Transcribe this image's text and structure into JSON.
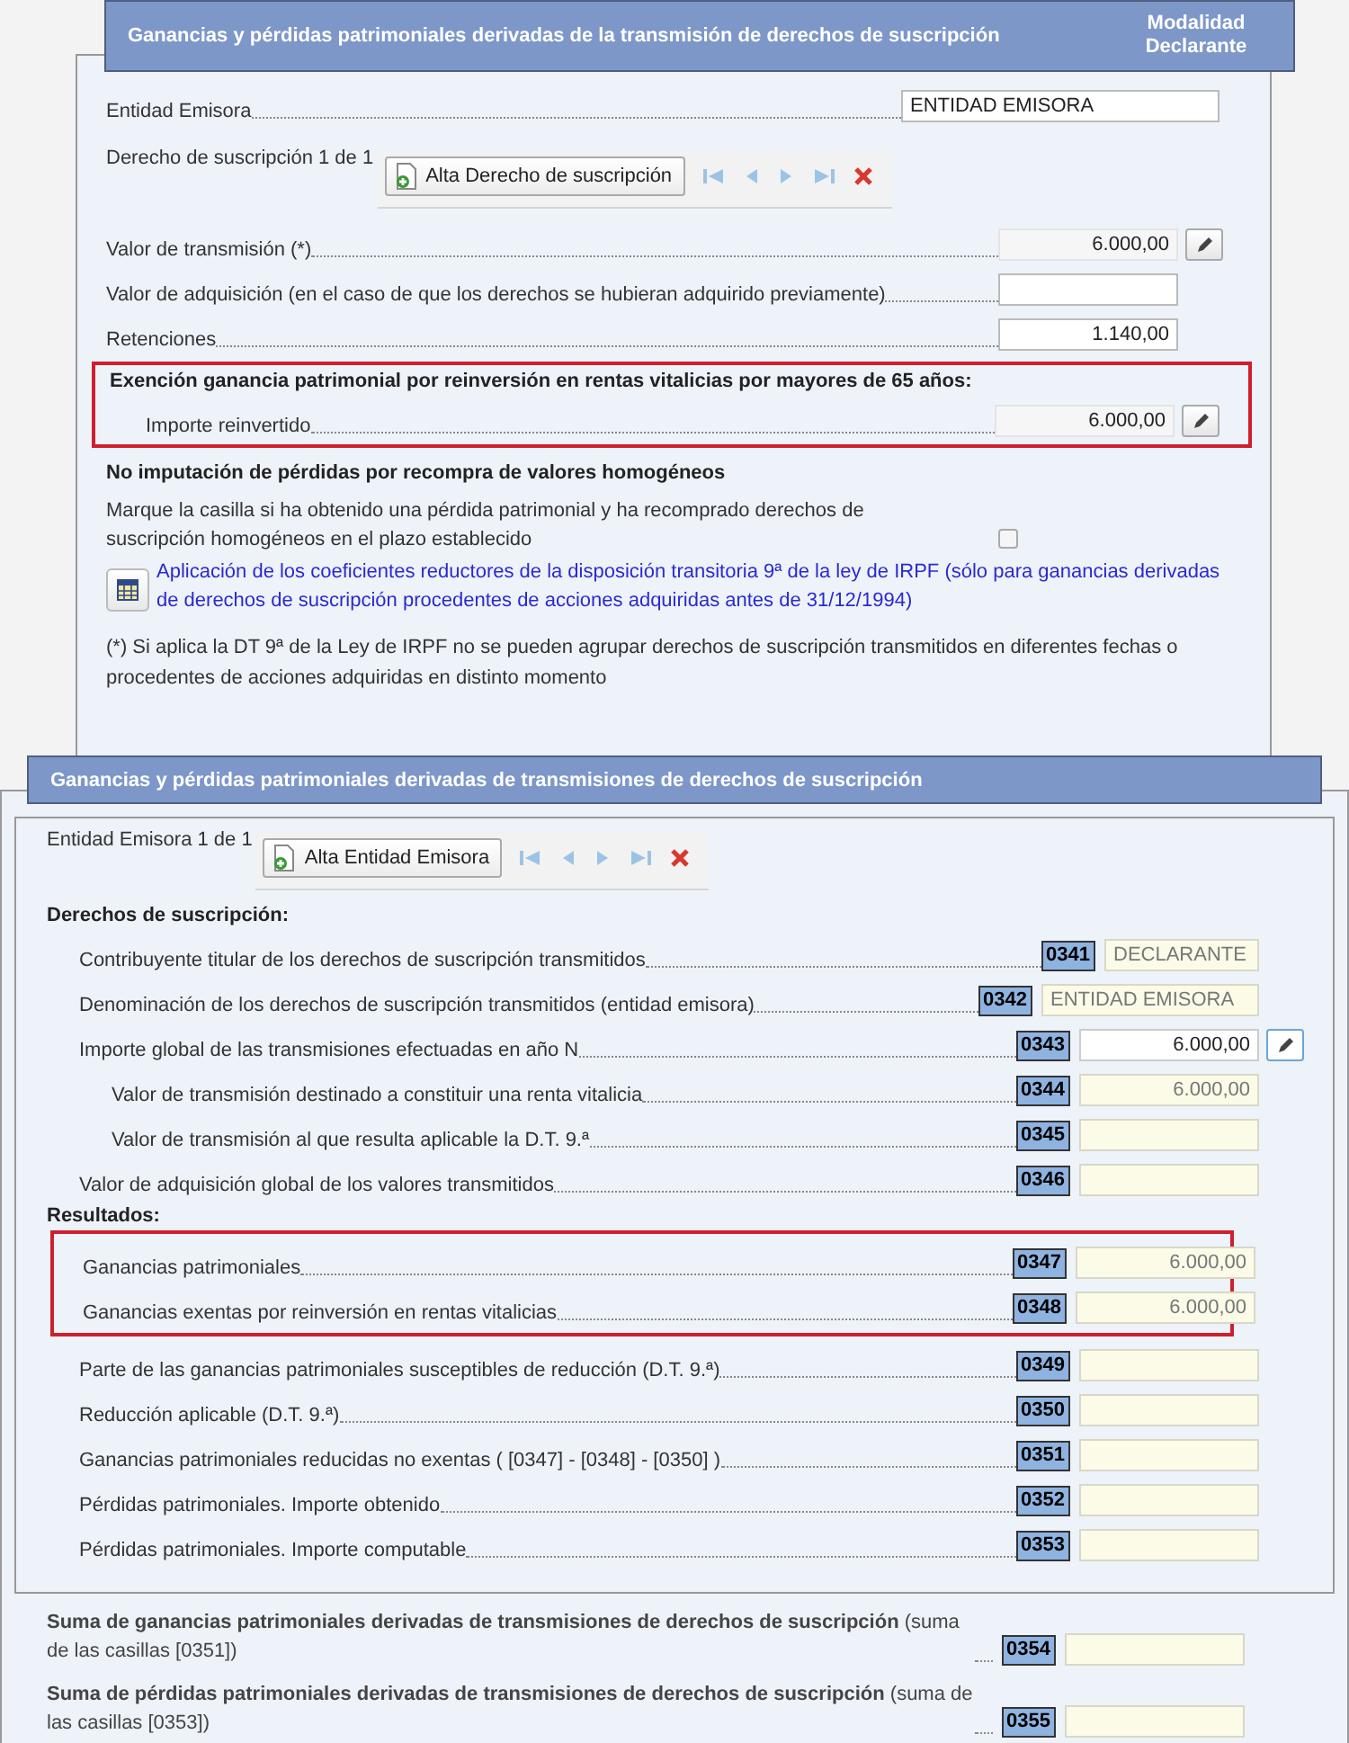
{
  "section_1": {
    "title": "Ganancias y pérdidas patrimoniales derivadas de la transmisión de derechos de suscripción",
    "mode_label": "Modalidad Declarante",
    "items": [
      {
        "kind": "text_field",
        "label": "Entidad Emisora",
        "value": "ENTIDAD EMISORA",
        "readonly": false,
        "edit_button": false
      },
      {
        "kind": "pager",
        "label": "Derecho de suscripción 1 de 1",
        "add_button": "Alta Derecho de suscripción"
      },
      {
        "kind": "amount_field",
        "label": "Valor de transmisión (*)",
        "value": "6.000,00",
        "readonly": true,
        "edit_button": true
      },
      {
        "kind": "amount_field",
        "label": "Valor de adquisición (en el caso de que los derechos se hubieran adquirido previamente)",
        "readonly": false,
        "edit_button": false
      },
      {
        "kind": "amount_field",
        "label": "Retenciones",
        "value": "1.140,00",
        "readonly": false,
        "edit_button": false
      },
      {
        "kind": "group",
        "highlighted": true,
        "heading": "Exención ganancia patrimonial por reinversión en rentas vitalicias por mayores de 65 años:",
        "children": [
          {
            "kind": "amount_field",
            "label": "Importe reinvertido",
            "value": "6.000,00",
            "readonly": true,
            "edit_button": true
          }
        ]
      },
      {
        "kind": "heading",
        "text": "No imputación de pérdidas por recompra de valores homogéneos"
      },
      {
        "kind": "checkbox",
        "text": "Marque la casilla si ha obtenido una pérdida patrimonial y ha recomprado derechos de suscripción homogéneos en el plazo establecido",
        "checked": false
      },
      {
        "kind": "link",
        "text": "Aplicación de los coeficientes reductores de la disposición transitoria 9ª de la ley de IRPF (sólo para ganancias derivadas de derechos de suscripción procedentes de acciones adquiridas antes de 31/12/1994)"
      },
      {
        "kind": "note",
        "text": "(*) Si aplica la DT 9ª de la Ley de IRPF no se pueden agrupar derechos de suscripción transmitidos en diferentes fechas o procedentes de acciones adquiridas en distinto momento"
      }
    ]
  },
  "section_2": {
    "title": "Ganancias y pérdidas patrimoniales derivadas de transmisiones de derechos de suscripción",
    "pager": {
      "label": "Entidad Emisora 1 de 1",
      "add_button": "Alta Entidad Emisora"
    },
    "groups": [
      {
        "heading": "Derechos de suscripción:",
        "rows": [
          {
            "kind": "text",
            "code": "0341",
            "label": "Contribuyente titular de los derechos de suscripción transmitidos",
            "value": "DECLARANTE",
            "readonly": true,
            "edit_button": false
          },
          {
            "kind": "text",
            "code": "0342",
            "label": "Denominación de los derechos de suscripción transmitidos (entidad emisora)",
            "value": "ENTIDAD EMISORA",
            "readonly": true,
            "edit_button": false
          },
          {
            "kind": "amount",
            "code": "0343",
            "label": "Importe global de las transmisiones efectuadas en año N",
            "value": "6.000,00",
            "readonly": false,
            "edit_button": true,
            "children": [
              {
                "kind": "amount",
                "code": "0344",
                "label": "Valor de transmisión destinado a constituir una renta vitalicia",
                "value": "6.000,00",
                "readonly": true,
                "edit_button": false
              },
              {
                "kind": "amount",
                "code": "0345",
                "label": "Valor de transmisión al que resulta aplicable la D.T. 9.ª",
                "readonly": true,
                "edit_button": false
              }
            ]
          },
          {
            "kind": "amount",
            "code": "0346",
            "label": "Valor de adquisición global de los valores transmitidos",
            "readonly": true,
            "edit_button": false
          }
        ]
      },
      {
        "heading": "Resultados:",
        "highlighted_rows": [
          {
            "kind": "amount",
            "code": "0347",
            "label": "Ganancias patrimoniales",
            "value": "6.000,00",
            "readonly": true,
            "edit_button": false
          },
          {
            "kind": "amount",
            "code": "0348",
            "label": "Ganancias exentas por reinversión en rentas vitalicias",
            "value": "6.000,00",
            "readonly": true,
            "edit_button": false
          }
        ],
        "rows": [
          {
            "kind": "amount",
            "code": "0349",
            "label": "Parte de las ganancias patrimoniales susceptibles de reducción (D.T. 9.ª)",
            "readonly": true,
            "edit_button": false
          },
          {
            "kind": "amount",
            "code": "0350",
            "label": "Reducción aplicable (D.T. 9.ª)",
            "readonly": true,
            "edit_button": false
          },
          {
            "kind": "amount",
            "code": "0351",
            "label": "Ganancias patrimoniales reducidas no exentas ( [0347] - [0348] - [0350] )",
            "readonly": true,
            "edit_button": false
          },
          {
            "kind": "amount",
            "code": "0352",
            "label": "Pérdidas patrimoniales. Importe obtenido",
            "readonly": true,
            "edit_button": false
          },
          {
            "kind": "amount",
            "code": "0353",
            "label": "Pérdidas patrimoniales. Importe computable",
            "readonly": true,
            "edit_button": false
          }
        ]
      }
    ],
    "totals": [
      {
        "code": "0354",
        "text": "**Suma de ganancias patrimoniales derivadas de transmisiones de derechos de suscripción** (suma de las casillas [0351])",
        "readonly": true
      },
      {
        "code": "0355",
        "text": "**Suma de pérdidas patrimoniales derivadas de transmisiones de derechos de suscripción** (suma de las casillas [0353])",
        "readonly": true
      }
    ]
  }
}
